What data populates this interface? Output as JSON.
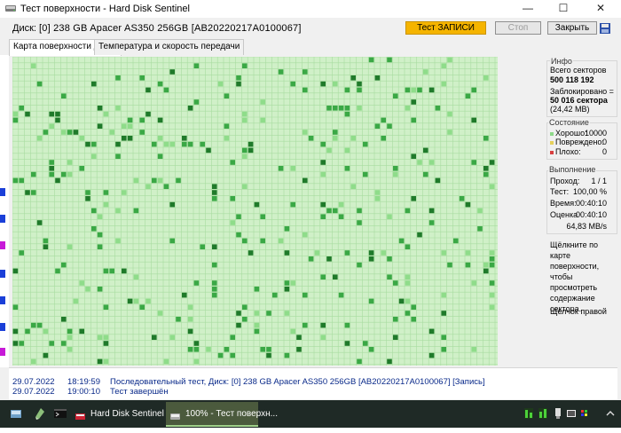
{
  "window": {
    "title": "Тест поверхности - Hard Disk Sentinel",
    "minimize": "—",
    "maximize": "☐",
    "close": "✕"
  },
  "disk": {
    "label": "Диск:",
    "value": "[0] 238 GB  Apacer AS350 256GB [AB20220217A0100067]"
  },
  "buttons": {
    "test": "Тест ЗАПИСИ",
    "stop": "Стоп",
    "close": "Закрыть"
  },
  "tabs": [
    {
      "label": "Карта поверхности диска"
    },
    {
      "label": "Температура и скорость передачи"
    }
  ],
  "info": {
    "title": "Инфо",
    "total_sectors_label": "Всего секторов",
    "total_sectors": "500 118 192",
    "blocked_label": "Заблокировано =",
    "blocked_value": "50 016 сектора",
    "blocked_size": "(24,42 MB)"
  },
  "status": {
    "title": "Состояние",
    "good_label": "Хорошо:",
    "good_value": "10000",
    "damaged_label": "Повреждено:",
    "damaged_value": "0",
    "bad_label": "Плохо:",
    "bad_value": "0",
    "good_color": "#8ed98a",
    "damaged_color": "#e6d05a",
    "bad_color": "#d84040"
  },
  "progress": {
    "title": "Выполнение",
    "pass_label": "Проход:",
    "pass_value": "1 / 1",
    "test_label": "Тест:",
    "test_value": "100,00 %",
    "time_label": "Время:",
    "time_value": "00:40:10",
    "estimate_label": "Оценка",
    "estimate_value": "00:40:10",
    "speed": "64,83 MB/s"
  },
  "hint": {
    "text": "Щёлкните по карте поверхности, чтобы просмотреть содержание сектора.",
    "right_click": "Щелчок правой"
  },
  "log": [
    {
      "date": "29.07.2022",
      "time": "18:19:59",
      "text": "Последовательный тест, Диск: [0] 238 GB  Apacer AS350 256GB [AB20220217A0100067] [Запись]"
    },
    {
      "date": "29.07.2022",
      "time": "19:00:10",
      "text": "Тест завершён"
    }
  ],
  "taskbar": {
    "task1": "Hard Disk Sentinel",
    "task2": "100% - Тест поверхн...",
    "tray_icons": [
      "gpu-icon",
      "cpu-icon",
      "usb-icon",
      "speaker-icon",
      "network-icon",
      "chevron-up-icon"
    ]
  },
  "colors": {
    "map_bg": "#d0f0c8",
    "map_grid": "#a8dca0",
    "block_dark": "#1f7a2a",
    "block_mid": "#3aa845",
    "block_light": "#8fdc8a",
    "accent_button": "#f5b400"
  }
}
